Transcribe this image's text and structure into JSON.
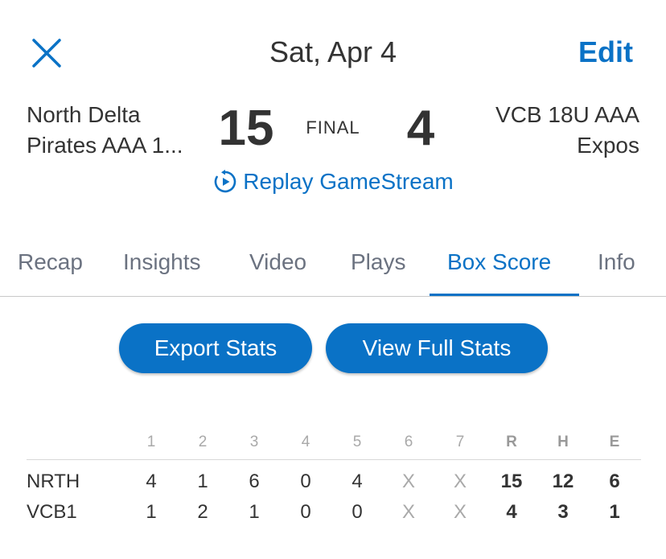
{
  "header": {
    "date": "Sat, Apr 4",
    "edit_label": "Edit"
  },
  "game": {
    "home_team_line1": "North Delta",
    "home_team_line2": "Pirates AAA 1...",
    "away_team_line1": "VCB 18U AAA",
    "away_team_line2": "Expos",
    "home_score": "15",
    "away_score": "4",
    "status": "FINAL",
    "replay_label": "Replay GameStream"
  },
  "tabs": [
    {
      "label": "Recap"
    },
    {
      "label": "Insights"
    },
    {
      "label": "Video"
    },
    {
      "label": "Plays"
    },
    {
      "label": "Box Score"
    },
    {
      "label": "Info"
    }
  ],
  "actions": {
    "export_label": "Export Stats",
    "view_full_label": "View Full Stats"
  },
  "box_score": {
    "columns": [
      "1",
      "2",
      "3",
      "4",
      "5",
      "6",
      "7",
      "R",
      "H",
      "E"
    ],
    "rows": [
      {
        "team": "NRTH",
        "innings": [
          "4",
          "1",
          "6",
          "0",
          "4",
          "X",
          "X"
        ],
        "r": "15",
        "h": "12",
        "e": "6"
      },
      {
        "team": "VCB1",
        "innings": [
          "1",
          "2",
          "1",
          "0",
          "0",
          "X",
          "X"
        ],
        "r": "4",
        "h": "3",
        "e": "1"
      }
    ]
  },
  "colors": {
    "accent": "#0a72c6",
    "text": "#333333",
    "muted": "#a9a9a9"
  },
  "icons": {
    "close": "close-icon",
    "replay": "replay-icon"
  }
}
